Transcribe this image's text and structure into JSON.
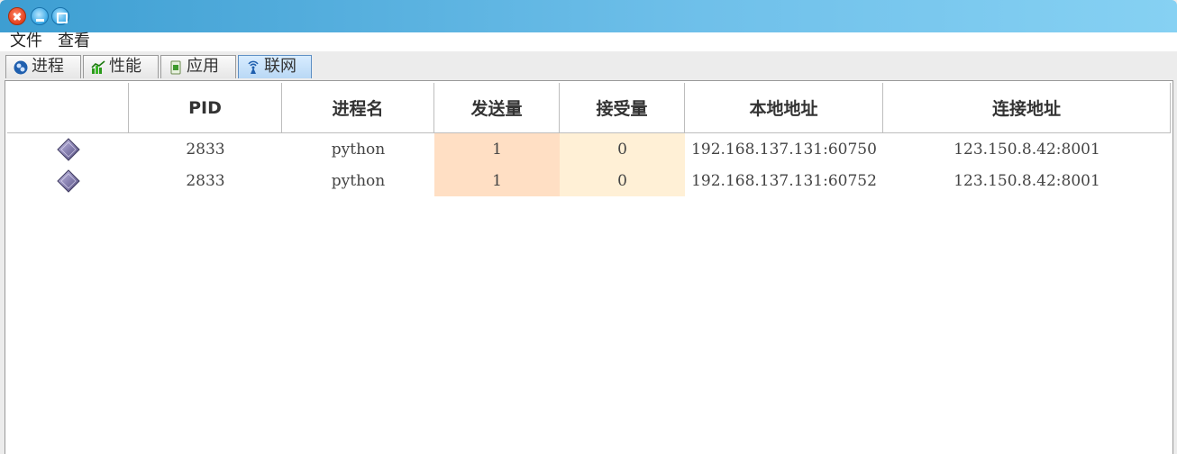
{
  "window": {
    "controls": [
      "close",
      "minimize",
      "maximize"
    ]
  },
  "menubar": {
    "items": [
      {
        "id": "file",
        "label": "文件"
      },
      {
        "id": "view",
        "label": "查看"
      }
    ]
  },
  "tabs": [
    {
      "id": "process",
      "label": "进程",
      "icon": "process-icon",
      "active": false
    },
    {
      "id": "performance",
      "label": "性能",
      "icon": "performance-chart-icon",
      "active": false
    },
    {
      "id": "apps",
      "label": "应用",
      "icon": "application-icon",
      "active": false
    },
    {
      "id": "network",
      "label": "联网",
      "icon": "antenna-icon",
      "active": true
    }
  ],
  "table": {
    "columns": [
      {
        "id": "icon",
        "label": ""
      },
      {
        "id": "pid",
        "label": "PID"
      },
      {
        "id": "name",
        "label": "进程名"
      },
      {
        "id": "sent",
        "label": "发送量"
      },
      {
        "id": "received",
        "label": "接受量"
      },
      {
        "id": "local",
        "label": "本地地址"
      },
      {
        "id": "remote",
        "label": "连接地址"
      }
    ],
    "rows": [
      {
        "icon": "process-diamond-icon",
        "pid": "2833",
        "name": "python",
        "sent": "1",
        "received": "0",
        "local": "192.168.137.131:60750",
        "remote": "123.150.8.42:8001"
      },
      {
        "icon": "process-diamond-icon",
        "pid": "2833",
        "name": "python",
        "sent": "1",
        "received": "0",
        "local": "192.168.137.131:60752",
        "remote": "123.150.8.42:8001"
      }
    ],
    "colors": {
      "sent_bg": "#ffdfc4",
      "received_bg": "#fff0d6"
    }
  }
}
